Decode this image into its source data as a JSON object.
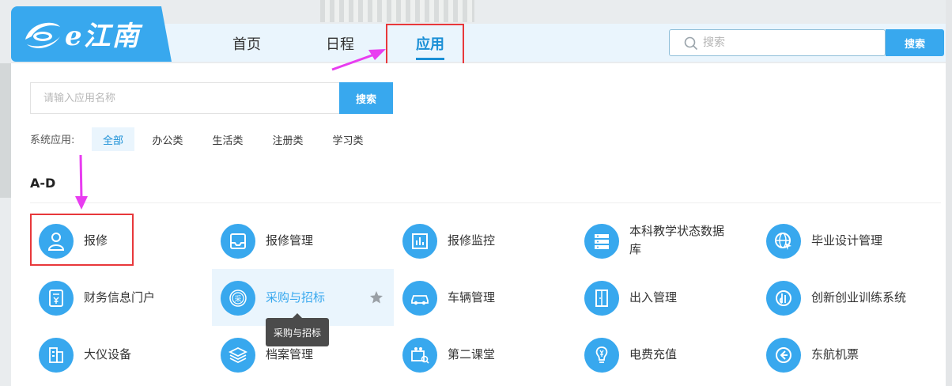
{
  "header": {
    "logo_text": "e江南",
    "nav": [
      "首页",
      "日程",
      "应用"
    ],
    "search_placeholder": "搜索",
    "search_button": "搜索"
  },
  "app_search": {
    "placeholder": "请输入应用名称",
    "button": "搜索"
  },
  "filters": {
    "label": "系统应用:",
    "items": [
      "全部",
      "办公类",
      "生活类",
      "注册类",
      "学习类"
    ],
    "active": "全部"
  },
  "section": {
    "title": "A-D"
  },
  "apps": [
    {
      "label": "报修",
      "icon": "person-icon"
    },
    {
      "label": "报修管理",
      "icon": "inbox-icon"
    },
    {
      "label": "报修监控",
      "icon": "monitor-chart-icon"
    },
    {
      "label": "本科教学状态数据库",
      "icon": "server-icon"
    },
    {
      "label": "毕业设计管理",
      "icon": "globe-cursor-icon"
    },
    {
      "label": "财务信息门户",
      "icon": "yen-document-icon"
    },
    {
      "label": "采购与招标",
      "icon": "purchase-seal-icon"
    },
    {
      "label": "车辆管理",
      "icon": "car-icon"
    },
    {
      "label": "出入管理",
      "icon": "door-icon"
    },
    {
      "label": "创新创业训练系统",
      "icon": "hand-circle-icon"
    },
    {
      "label": "大仪设备",
      "icon": "building-icon"
    },
    {
      "label": "档案管理",
      "icon": "layers-icon"
    },
    {
      "label": "第二课堂",
      "icon": "classroom-search-icon"
    },
    {
      "label": "电费充值",
      "icon": "bulb-yen-icon"
    },
    {
      "label": "东航机票",
      "icon": "arrow-circle-icon"
    }
  ],
  "tooltip": "采购与招标",
  "colors": {
    "primary": "#38a8ee",
    "accent_text": "#1a8fd6",
    "annotation_box": "#e8383b",
    "annotation_arrow": "#e83df0"
  }
}
